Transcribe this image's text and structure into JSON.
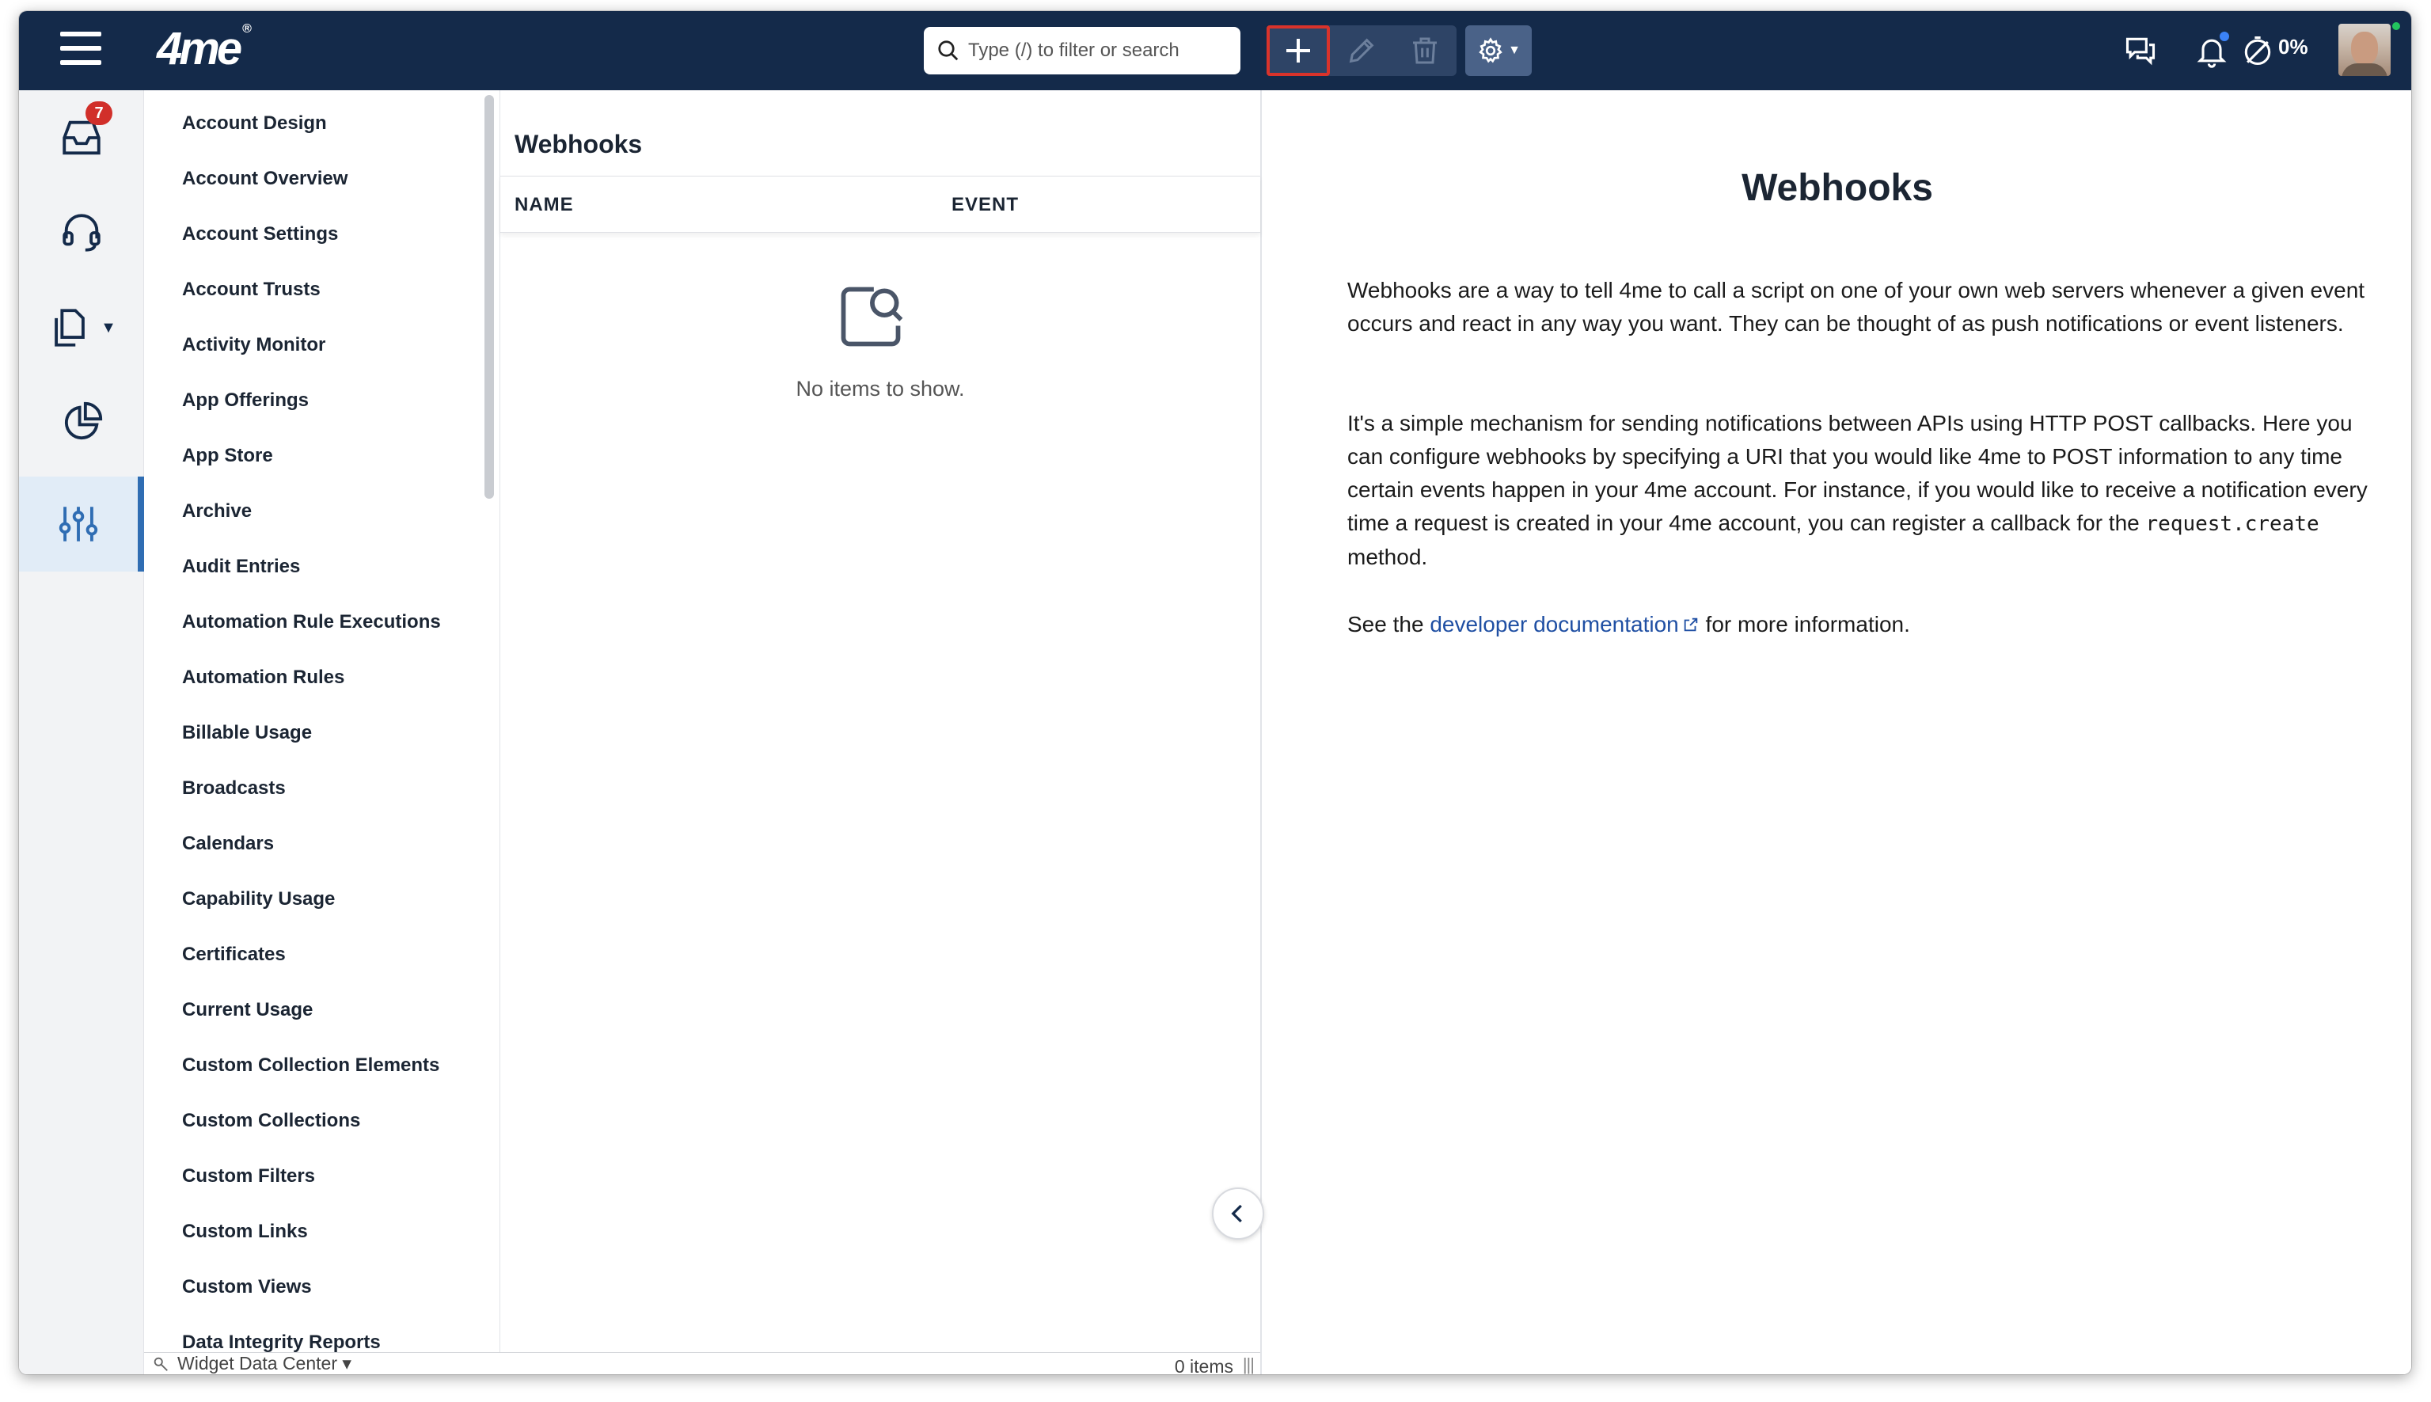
{
  "app": {
    "logo": "4me",
    "logo_mark": "®"
  },
  "toolbar": {
    "search_placeholder": "Type (/) to filter or search",
    "progress_label": "0%"
  },
  "rail": {
    "inbox_badge": "7"
  },
  "settings_nav": {
    "items": [
      {
        "label": "Account Design"
      },
      {
        "label": "Account Overview"
      },
      {
        "label": "Account Settings"
      },
      {
        "label": "Account Trusts"
      },
      {
        "label": "Activity Monitor"
      },
      {
        "label": "App Offerings"
      },
      {
        "label": "App Store"
      },
      {
        "label": "Archive"
      },
      {
        "label": "Audit Entries"
      },
      {
        "label": "Automation Rule Executions"
      },
      {
        "label": "Automation Rules"
      },
      {
        "label": "Billable Usage"
      },
      {
        "label": "Broadcasts"
      },
      {
        "label": "Calendars"
      },
      {
        "label": "Capability Usage"
      },
      {
        "label": "Certificates"
      },
      {
        "label": "Current Usage"
      },
      {
        "label": "Custom Collection Elements"
      },
      {
        "label": "Custom Collections"
      },
      {
        "label": "Custom Filters"
      },
      {
        "label": "Custom Links"
      },
      {
        "label": "Custom Views"
      },
      {
        "label": "Data Integrity Reports"
      }
    ],
    "footer": "Widget Data Center ▾"
  },
  "list": {
    "title": "Webhooks",
    "columns": [
      "NAME",
      "EVENT"
    ],
    "empty_text": "No items to show.",
    "count": "0 items"
  },
  "detail": {
    "title": "Webhooks",
    "para1": "Webhooks are a way to tell 4me to call a script on one of your own web servers whenever a given event occurs and react in any way you want. They can be thought of as push notifications or event listeners.",
    "para2_prefix": "It's a simple mechanism for sending notifications between APIs using HTTP POST callbacks. Here you can configure webhooks by specifying a URI that you would like 4me to POST information to any time certain events happen in your 4me account. For instance, if you would like to receive a notification every time a request is created in your 4me account, you can register a callback for the ",
    "para2_code": "request.create",
    "para2_suffix": " method.",
    "para3_prefix": "See the ",
    "para3_link": "developer documentation",
    "para3_suffix": " for more information."
  },
  "colors": {
    "topbar": "#142a4a",
    "accent": "#2f6db3",
    "badge": "#d12f2a",
    "highlight_border": "#d9332b",
    "link": "#1f4fa3"
  },
  "icons": [
    "menu-icon",
    "search-icon",
    "add-icon",
    "edit-icon",
    "delete-icon",
    "gear-icon",
    "chat-icon",
    "bell-icon",
    "timer-icon",
    "inbox-icon",
    "headset-icon",
    "documents-icon",
    "pie-chart-icon",
    "sliders-icon",
    "empty-search-icon",
    "chevron-left-icon",
    "external-link-icon",
    "widget-icon"
  ]
}
